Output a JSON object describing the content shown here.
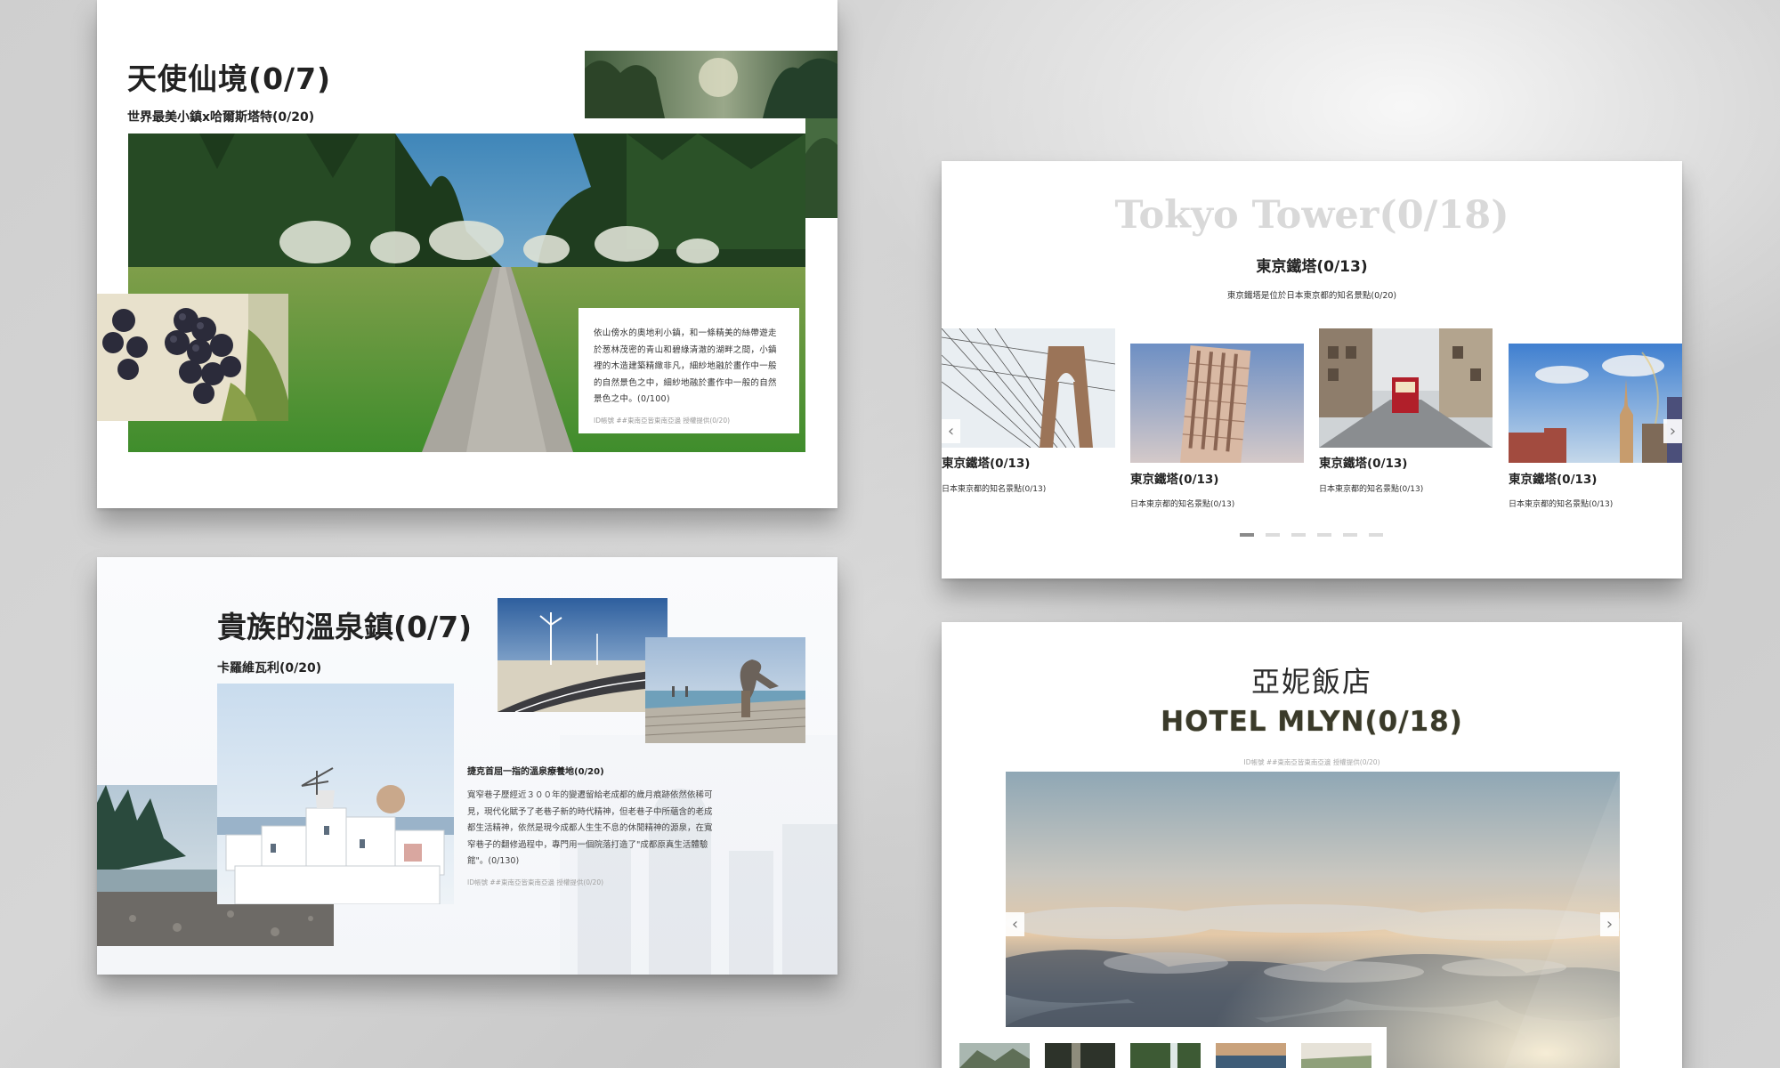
{
  "panels": {
    "angel": {
      "title": "天使仙境(0/7)",
      "subtitle": "世界最美小鎮x哈爾斯塔特(0/20)",
      "description": "依山傍水的奧地利小鎮，和一條精美的絲帶遊走於葱林茂密的青山和碧綠清澈的湖畔之間，小鎮裡的木造建築精緻非凡，細紗地融於畫作中一般的自然景色之中，細紗地融於畫作中一般的自然景色之中。(0/100)",
      "credit": "ID帳號 ##東南亞皆東南亞邊 授權提供(0/20)"
    },
    "noble": {
      "title": "貴族的溫泉鎮(0/7)",
      "subtitle": "卡羅維瓦利(0/20)",
      "heading": "捷克首屈一指的溫泉療養地(0/20)",
      "description": "寬窄巷子歷經近３００年的變遷留給老成都的歲月痕跡依然依稀可見，現代化賦予了老巷子新的時代精神，但老巷子中所蘊含的老成都生活精神，依然是現今成都人生生不息的休閒精神的源泉，在寬窄巷子的翻修過程中，專門用一個院落打造了\"成都原真生活體驗館\"。(0/130)",
      "credit": "ID帳號 ##東南亞皆東南亞邊 授權提供(0/20)"
    },
    "tokyo": {
      "title": "Tokyo Tower(0/18)",
      "subtitle": "東京鐵塔(0/13)",
      "description": "東京鐵塔是位於日本東京都的知名景點(0/20)",
      "slides": [
        {
          "title": "東京鐵塔(0/13)",
          "caption": "日本東京都的知名景點(0/13)"
        },
        {
          "title": "東京鐵塔(0/13)",
          "caption": "日本東京都的知名景點(0/13)"
        },
        {
          "title": "東京鐵塔(0/13)",
          "caption": "日本東京都的知名景點(0/13)"
        },
        {
          "title": "東京鐵塔(0/13)",
          "caption": "日本東京都的知名景點(0/13)"
        }
      ],
      "prev_arrow": "‹",
      "next_arrow": "›",
      "dots": 6,
      "active_dot": 1
    },
    "hotel": {
      "title": "亞妮飯店",
      "subtitle": "HOTEL MLYN(0/18)",
      "credit": "ID帳號 ##東南亞皆東南亞邊 授權提供(0/20)",
      "prev_arrow": "‹",
      "next_arrow": "›"
    }
  },
  "colors": {
    "background": "#cfcfcf",
    "card": "#ffffff",
    "title_text": "#222222",
    "tokyo_title_ghost": "#d9d9d9"
  }
}
